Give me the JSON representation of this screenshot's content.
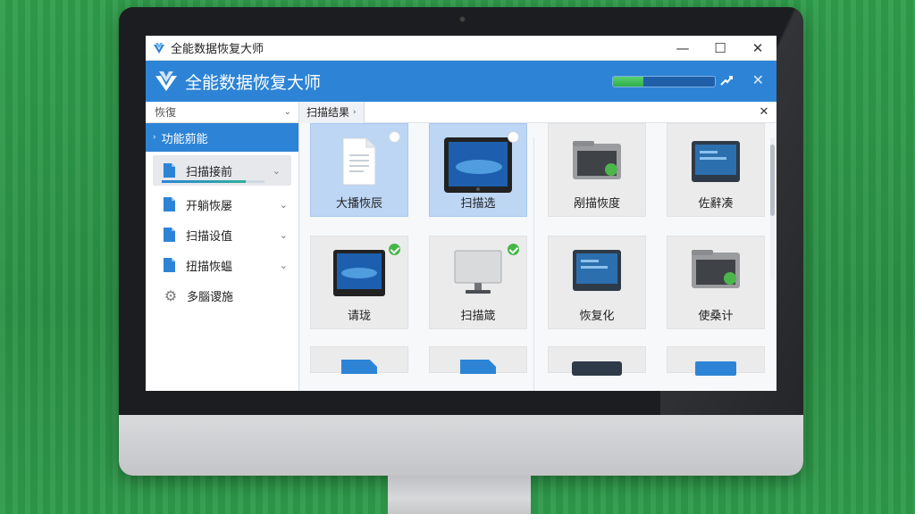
{
  "window": {
    "title": "全能数据恢复大师",
    "controls": {
      "minimize": "—",
      "maximize": "☐",
      "close": "✕"
    }
  },
  "banner": {
    "title": "全能数据恢复大师",
    "close": "✕",
    "progress_percent": 30
  },
  "sidebar": {
    "search_text": "恢復",
    "section_title": "功能莂能",
    "items": [
      {
        "label": "扫描接前",
        "icon": "document-icon",
        "active": true,
        "has_chevron": true,
        "progress_percent": 82
      },
      {
        "label": "开躺恢屡",
        "icon": "document-icon",
        "active": false,
        "has_chevron": true
      },
      {
        "label": "扫描设值",
        "icon": "document-icon",
        "active": false,
        "has_chevron": true
      },
      {
        "label": "扭描恢蝹",
        "icon": "document-icon",
        "active": false,
        "has_chevron": true
      },
      {
        "label": "多腦谡施",
        "icon": "gear-icon",
        "active": false,
        "has_chevron": false
      }
    ]
  },
  "content": {
    "breadcrumb": "扫描结果",
    "close": "✕",
    "tiles": [
      {
        "label": "大播恢辰",
        "icon": "document-icon",
        "selected": true,
        "check": "empty"
      },
      {
        "label": "扫描选",
        "icon": "tablet-icon",
        "selected": true,
        "check": "empty"
      },
      {
        "label": "剐描恢度",
        "icon": "drive-icon",
        "selected": false,
        "check": "none"
      },
      {
        "label": "佐辭凑",
        "icon": "monitor-icon",
        "selected": false,
        "check": "none"
      },
      {
        "label": "请珑",
        "icon": "tablet-icon",
        "selected": false,
        "check": "on"
      },
      {
        "label": "扫描箴",
        "icon": "display-icon",
        "selected": false,
        "check": "on"
      },
      {
        "label": "恢复化",
        "icon": "monitor-icon",
        "selected": false,
        "check": "none"
      },
      {
        "label": "使桑计",
        "icon": "drive-icon",
        "selected": false,
        "check": "none"
      }
    ]
  },
  "colors": {
    "accent_blue": "#2d84d6",
    "selected_tile": "#bcd6f4",
    "check_green": "#45b649",
    "background_green": "#2f9a4a"
  }
}
